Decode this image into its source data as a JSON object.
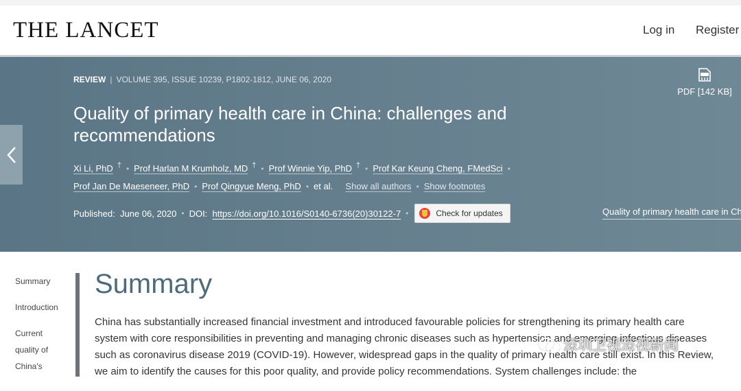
{
  "header": {
    "logo": "THE LANCET",
    "login_label": "Log in",
    "register_label": "Register"
  },
  "hero": {
    "article_type": "REVIEW",
    "volume_info": "VOLUME 395, ISSUE 10239, P1802-1812, JUNE 06, 2020",
    "title": "Quality of primary health care in China: challenges and recommendations",
    "authors": [
      {
        "name": "Xi Li, PhD",
        "dagger": "†"
      },
      {
        "name": "Prof Harlan M Krumholz, MD",
        "dagger": "†"
      },
      {
        "name": "Prof Winnie Yip, PhD",
        "dagger": "†"
      },
      {
        "name": "Prof Kar Keung Cheng, FMedSci",
        "dagger": ""
      },
      {
        "name": "Prof Jan De Maeseneer, PhD",
        "dagger": ""
      },
      {
        "name": "Prof Qingyue Meng, PhD",
        "dagger": ""
      }
    ],
    "et_al": "et al.",
    "show_all_authors": "Show all authors",
    "show_footnotes": "Show footnotes",
    "published_label": "Published:",
    "published_date": "June 06, 2020",
    "doi_label": "DOI:",
    "doi_value": "https://doi.org/10.1016/S0140-6736(20)30122-7",
    "check_updates_label": "Check for updates",
    "pdf_label": "PDF [142 KB]",
    "related_link": "Quality of primary health care in China: challenges and recommendations"
  },
  "toc": {
    "items": [
      "Summary",
      "Introduction",
      "Current quality of China's"
    ]
  },
  "main": {
    "heading": "Summary",
    "paragraph": "China has substantially increased financial investment and introduced favourable policies for strengthening its primary health care system with core responsibilities in preventing and managing chronic diseases such as hypertension and emerging infectious diseases such as coronavirus disease 2019 (COVID-19). However, widespread gaps in the quality of primary health care still exist. In this Review, we aim to identify the causes for this poor quality, and provide policy recommendations. System challenges include: the"
  },
  "watermark": {
    "text": "深圳卫视深视新闻",
    "icon": "wechat-icon"
  },
  "colors": {
    "hero_bg": "#5a7585",
    "heading_color": "#4f6b7a",
    "check_icon": "#e8433a"
  }
}
